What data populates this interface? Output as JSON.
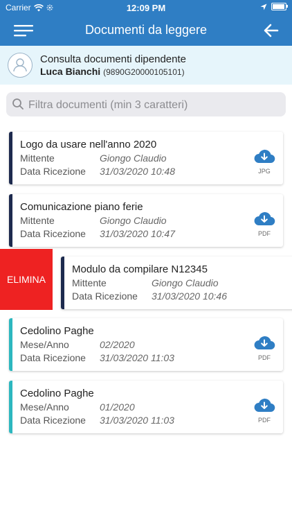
{
  "status_bar": {
    "carrier": "Carrier",
    "time": "12:09 PM"
  },
  "nav": {
    "title": "Documenti da leggere"
  },
  "user": {
    "line1": "Consulta documenti dipendente",
    "name": "Luca Bianchi",
    "code": "(9890G20000105101)"
  },
  "search": {
    "placeholder": "Filtra documenti (min 3 caratteri)"
  },
  "delete_label": "ELIMINA",
  "colors": {
    "primary": "#2f7ec4",
    "dark_bar": "#1d2a4e",
    "teal_bar": "#2cb7bf",
    "delete": "#ee2222",
    "banner": "#e6f5fb"
  },
  "documents": [
    {
      "title": "Logo da usare nell'anno 2020",
      "label1": "Mittente",
      "value1": "Giongo Claudio",
      "label2": "Data Ricezione",
      "value2": "31/03/2020 10:48",
      "file_type": "JPG"
    },
    {
      "title": "Comunicazione piano ferie",
      "label1": "Mittente",
      "value1": "Giongo Claudio",
      "label2": "Data Ricezione",
      "value2": "31/03/2020 10:47",
      "file_type": "PDF"
    },
    {
      "title": "Modulo da compilare N12345",
      "label1": "Mittente",
      "value1": "Giongo Claudio",
      "label2": "Data Ricezione",
      "value2": "31/03/2020 10:46",
      "file_type": ""
    },
    {
      "title": "Cedolino Paghe",
      "label1": "Mese/Anno",
      "value1": "02/2020",
      "label2": "Data Ricezione",
      "value2": "31/03/2020 11:03",
      "file_type": "PDF"
    },
    {
      "title": "Cedolino Paghe",
      "label1": "Mese/Anno",
      "value1": "01/2020",
      "label2": "Data Ricezione",
      "value2": "31/03/2020 11:03",
      "file_type": "PDF"
    }
  ]
}
